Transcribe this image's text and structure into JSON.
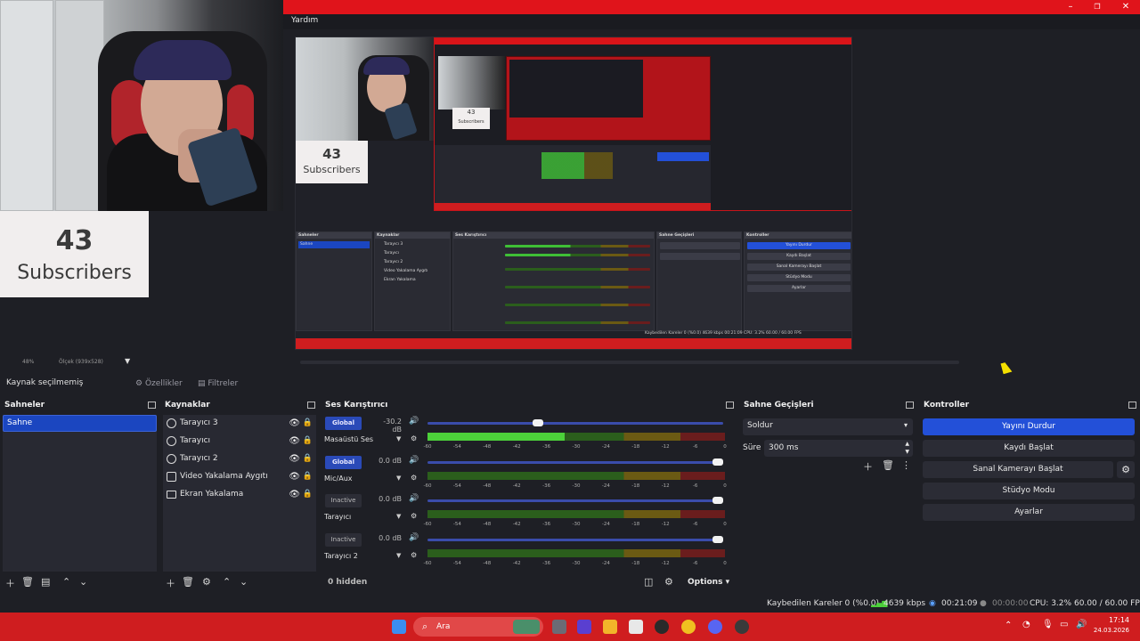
{
  "menubar": {
    "help_label": "Yardım"
  },
  "window_controls": {
    "minimize": "–",
    "maximize": "❐",
    "close": "✕"
  },
  "overlay": {
    "subscriber_count": "43",
    "subscriber_label": "Subscribers"
  },
  "preview": {
    "zoom_text": "48%",
    "zoom_detail": "Ölçek (939x528)",
    "mini": {
      "scenes_title": "Sahneler",
      "scene_item": "Sahne",
      "sources_title": "Kaynaklar",
      "sources": [
        "Tarayıcı 3",
        "Tarayıcı",
        "Tarayıcı 2",
        "Video Yakalama Aygıtı",
        "Ekran Yakalama"
      ],
      "mixer_title": "Ses Karıştırıcı",
      "transitions_title": "Sahne Geçişleri",
      "controls_title": "Kontroller",
      "controls": [
        "Yayını Durdur",
        "Kaydı Başlat",
        "Sanal Kamerayı Başlat",
        "Stüdyo Modu",
        "Ayarlar"
      ],
      "status": "Kaybedilen Kareler 0 (%0.0)   4639 kbps   00:21:09   CPU: 3.2%   60.00 / 60.00 FPS"
    }
  },
  "context": {
    "no_source": "Kaynak seçilmemiş",
    "properties": "Özellikler",
    "filters": "Filtreler"
  },
  "scenes": {
    "title": "Sahneler",
    "items": [
      "Sahne"
    ]
  },
  "sources": {
    "title": "Kaynaklar",
    "items": [
      {
        "label": "Tarayıcı 3",
        "icon": "globe-icon"
      },
      {
        "label": "Tarayıcı",
        "icon": "globe-icon"
      },
      {
        "label": "Tarayıcı 2",
        "icon": "globe-icon"
      },
      {
        "label": "Video Yakalama Aygıtı",
        "icon": "camera-icon"
      },
      {
        "label": "Ekran Yakalama",
        "icon": "monitor-icon"
      }
    ]
  },
  "mixer": {
    "title": "Ses Karıştırıcı",
    "channels": [
      {
        "badge": "Global",
        "badge_type": "global",
        "db": "-30.2 dB",
        "name": "Masaüstü Ses",
        "volume": 0.37,
        "level": 0.46
      },
      {
        "badge": "Global",
        "badge_type": "global",
        "db": "0.0 dB",
        "name": "Mic/Aux",
        "volume": 1.0,
        "level": 0.0
      },
      {
        "badge": "Inactive",
        "badge_type": "inactive",
        "db": "0.0 dB",
        "name": "Tarayıcı",
        "volume": 1.0,
        "level": 0.0
      },
      {
        "badge": "Inactive",
        "badge_type": "inactive",
        "db": "0.0 dB",
        "name": "Tarayıcı 2",
        "volume": 1.0,
        "level": 0.0
      }
    ],
    "scale": [
      "-60",
      "-54",
      "-48",
      "-42",
      "-36",
      "-30",
      "-24",
      "-18",
      "-12",
      "-6",
      "0"
    ],
    "hidden_label": "0 hidden",
    "options_label": "Options"
  },
  "transitions": {
    "title": "Sahne Geçişleri",
    "selected": "Soldur",
    "duration_label": "Süre",
    "duration_value": "300 ms"
  },
  "controls": {
    "title": "Kontroller",
    "stop_stream": "Yayını Durdur",
    "start_record": "Kaydı Başlat",
    "start_virtualcam": "Sanal Kamerayı Başlat",
    "studio_mode": "Stüdyo Modu",
    "settings": "Ayarlar"
  },
  "status": {
    "dropped_frames": "Kaybedilen Kareler 0 (%0.0)",
    "bitrate": "4639 kbps",
    "stream_time": "00:21:09",
    "record_time": "00:00:00",
    "cpu": "CPU: 3.2%",
    "fps": "60.00 / 60.00 FPS"
  },
  "taskbar": {
    "search_placeholder": "Ara",
    "time": "17:14",
    "date": "24.03.2026",
    "accent": "#cf1d1f"
  },
  "colors": {
    "accent_blue": "#2350d8",
    "title_red": "#e0141b"
  }
}
